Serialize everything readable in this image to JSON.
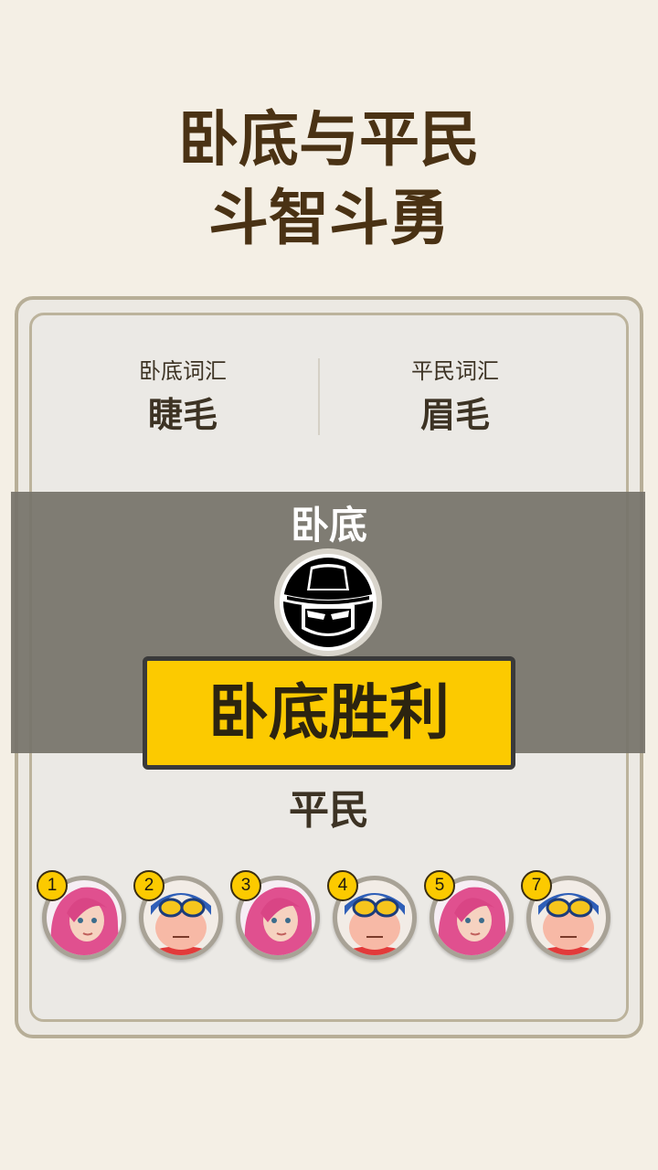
{
  "headline": {
    "line1": "卧底与平民",
    "line2": "斗智斗勇"
  },
  "words": {
    "spy_label": "卧底词汇",
    "spy_word": "睫毛",
    "civilian_label": "平民词汇",
    "civilian_word": "眉毛"
  },
  "result": {
    "revealed_role": "卧底",
    "spy_avatar_icon": "spy-hat-mask-icon",
    "banner": "卧底胜利"
  },
  "civilians": {
    "label": "平民",
    "players": [
      {
        "number": "1",
        "avatar": "pink-hair-girl-avatar"
      },
      {
        "number": "2",
        "avatar": "goggles-boy-avatar"
      },
      {
        "number": "3",
        "avatar": "pink-hair-girl-avatar"
      },
      {
        "number": "4",
        "avatar": "goggles-boy-avatar"
      },
      {
        "number": "5",
        "avatar": "pink-hair-girl-avatar"
      },
      {
        "number": "7",
        "avatar": "goggles-boy-avatar"
      }
    ]
  },
  "colors": {
    "banner": "#fcca00",
    "headline": "#4a3214",
    "background": "#f4efe5"
  }
}
